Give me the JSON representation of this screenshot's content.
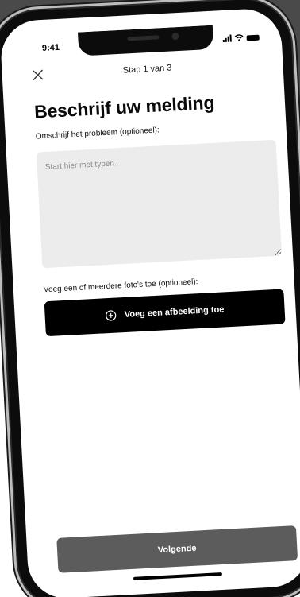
{
  "status_bar": {
    "time": "9:41"
  },
  "header": {
    "step_label": "Stap 1 van 3",
    "close_icon": "close-icon"
  },
  "page": {
    "title": "Beschrijf uw melding",
    "description_label": "Omschrijf het probleem (optioneel):",
    "description_placeholder": "Start hier met typen...",
    "description_value": "",
    "photo_label": "Voeg een of meerdere foto's toe (optioneel):",
    "add_image_label": "Voeg een afbeelding toe",
    "add_image_icon": "plus-circle-icon",
    "next_label": "Volgende"
  },
  "colors": {
    "primary_button": "#000000",
    "disabled_button": "#5c5c5c",
    "input_background": "#ececec",
    "background_panel": "#4a4a4a"
  }
}
